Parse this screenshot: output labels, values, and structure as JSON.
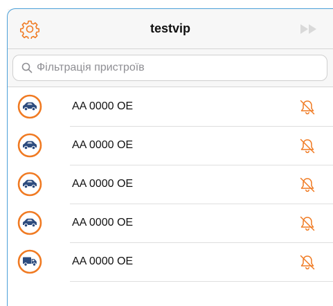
{
  "header": {
    "title": "testvip",
    "settings_icon": "gear-icon",
    "forward_icon": "fast-forward-icon"
  },
  "search": {
    "placeholder": "Фільтрація пристроїв",
    "value": ""
  },
  "devices": [
    {
      "name": "AA 0000 OE",
      "vehicle": "car",
      "muted": true
    },
    {
      "name": "AA 0000 OE",
      "vehicle": "car",
      "muted": true
    },
    {
      "name": "AA 0000 OE",
      "vehicle": "car",
      "muted": true
    },
    {
      "name": "AA 0000 OE",
      "vehicle": "car",
      "muted": true
    },
    {
      "name": "AA 0000 OE",
      "vehicle": "truck",
      "muted": true
    }
  ],
  "colors": {
    "accent": "#f07a22",
    "vehicle_blue": "#2c4b7e",
    "frame_blue": "#4a9fd8",
    "bar_bg": "#f7f7f7"
  }
}
